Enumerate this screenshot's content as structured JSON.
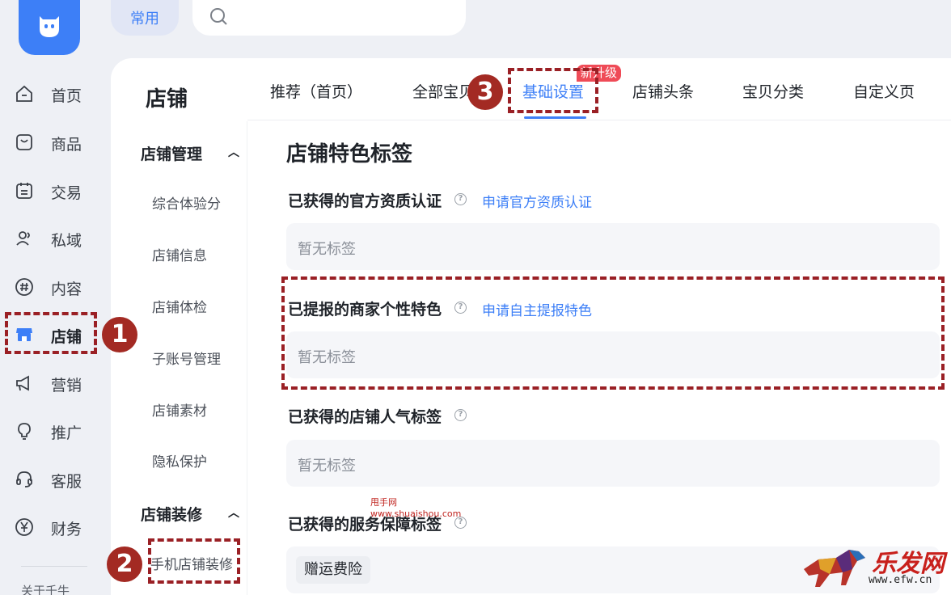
{
  "topbar": {
    "common_label": "常用",
    "search_placeholder": ""
  },
  "nav": [
    {
      "label": "首页",
      "icon": "home-icon"
    },
    {
      "label": "商品",
      "icon": "goods-icon"
    },
    {
      "label": "交易",
      "icon": "trade-icon"
    },
    {
      "label": "私域",
      "icon": "users-icon"
    },
    {
      "label": "内容",
      "icon": "hash-icon"
    },
    {
      "label": "店铺",
      "icon": "store-icon"
    },
    {
      "label": "营销",
      "icon": "megaphone-icon"
    },
    {
      "label": "推广",
      "icon": "bulb-icon"
    },
    {
      "label": "客服",
      "icon": "headset-icon"
    },
    {
      "label": "财务",
      "icon": "yen-icon"
    }
  ],
  "rail_footer": "关于千牛",
  "page_title": "店铺",
  "submenu": {
    "group1_title": "店铺管理",
    "group1_items": [
      "综合体验分",
      "店铺信息",
      "店铺体检",
      "子账号管理",
      "店铺素材",
      "隐私保护"
    ],
    "group2_title": "店铺装修",
    "group2_items": [
      "手机店铺装修"
    ]
  },
  "tabs": [
    "推荐（首页）",
    "全部宝贝",
    "基础设置",
    "店铺头条",
    "宝贝分类",
    "自定义页"
  ],
  "tab_badge": "新升级",
  "section_title": "店铺特色标签",
  "fields": [
    {
      "label": "已获得的官方资质认证",
      "link": "申请官方资质认证",
      "empty": "暂无标签"
    },
    {
      "label": "已提报的商家个性特色",
      "link": "申请自主提报特色",
      "empty": "暂无标签"
    },
    {
      "label": "已获得的店铺人气标签",
      "empty": "暂无标签"
    },
    {
      "label": "已获得的服务保障标签",
      "chip": "赠运费险"
    }
  ],
  "annotations": [
    "1",
    "2",
    "3"
  ],
  "watermark": {
    "line1": "甩手网",
    "line2": "www.shuaishou.com"
  },
  "corner_logo": {
    "title": "乐发网",
    "url": "www.efw.cn"
  },
  "colors": {
    "accent": "#3d7ff7",
    "annotation": "#9a2025",
    "badge": "#ef4b57"
  }
}
